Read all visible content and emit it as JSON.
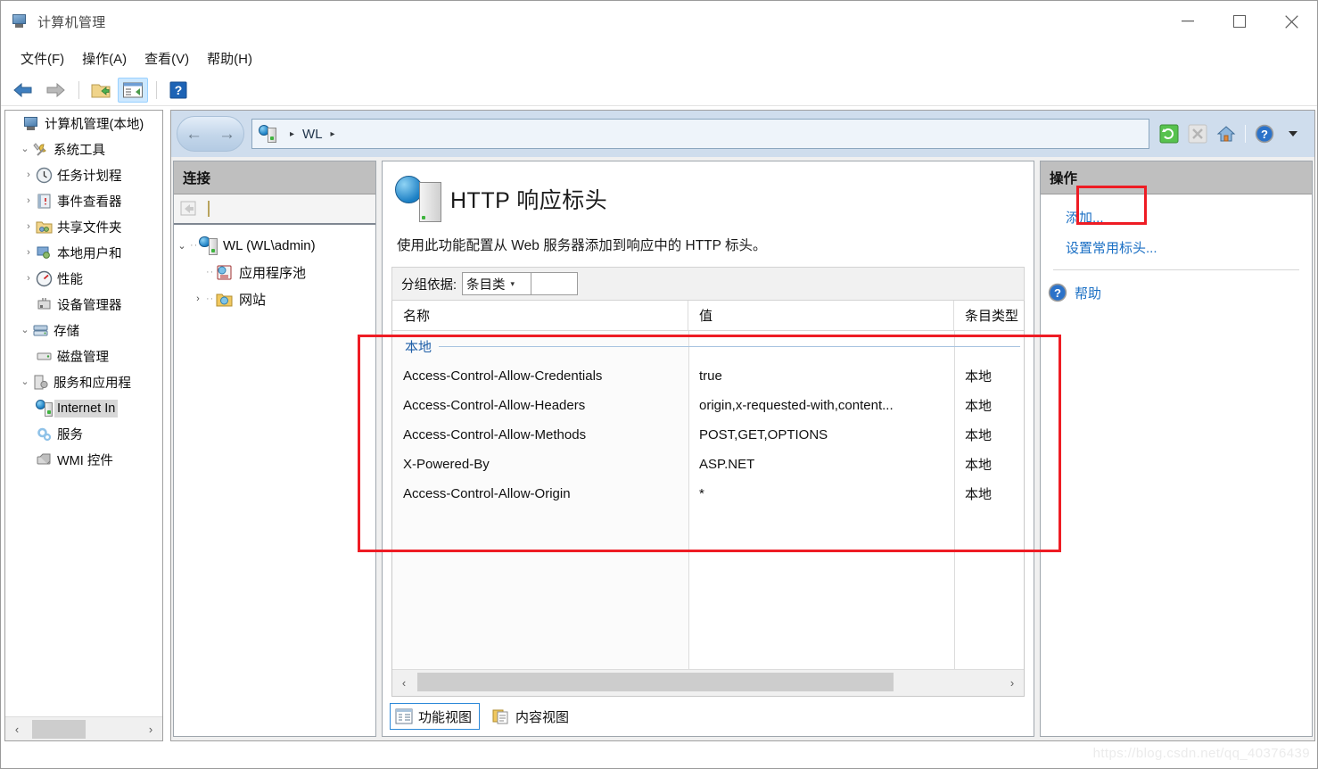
{
  "window": {
    "title": "计算机管理",
    "icon": "computer-management-icon",
    "minimize_label": "最小化",
    "maximize_label": "最大化",
    "close_label": "关闭"
  },
  "menubar": {
    "items": [
      {
        "label": "文件(F)",
        "name": "menu-file"
      },
      {
        "label": "操作(A)",
        "name": "menu-action"
      },
      {
        "label": "查看(V)",
        "name": "menu-view"
      },
      {
        "label": "帮助(H)",
        "name": "menu-help"
      }
    ]
  },
  "mmc_toolbar": {
    "buttons": [
      {
        "name": "back-button",
        "icon": "arrow-left-icon",
        "enabled": true
      },
      {
        "name": "forward-button",
        "icon": "arrow-right-icon",
        "enabled": true
      },
      {
        "name": "show-hide-console-tree-button",
        "icon": "folder-up-icon",
        "enabled": true
      },
      {
        "name": "show-hide-action-pane-button",
        "icon": "pane-icon",
        "pressed": true
      },
      {
        "name": "help-button",
        "icon": "question-icon",
        "enabled": true
      }
    ]
  },
  "console_tree": {
    "nodes": [
      {
        "label": "计算机管理(本地)",
        "icon": "computer-icon",
        "level": 0,
        "twist": "",
        "selected": false
      },
      {
        "label": "系统工具",
        "icon": "tools-icon",
        "level": 1,
        "twist": "v",
        "selected": false
      },
      {
        "label": "任务计划程",
        "icon": "clock-icon",
        "level": 2,
        "twist": ">",
        "selected": false
      },
      {
        "label": "事件查看器",
        "icon": "eventlog-icon",
        "level": 2,
        "twist": ">",
        "selected": false
      },
      {
        "label": "共享文件夹",
        "icon": "shared-folder-icon",
        "level": 2,
        "twist": ">",
        "selected": false
      },
      {
        "label": "本地用户和",
        "icon": "users-icon",
        "level": 2,
        "twist": ">",
        "selected": false
      },
      {
        "label": "性能",
        "icon": "performance-icon",
        "level": 2,
        "twist": ">",
        "selected": false
      },
      {
        "label": "设备管理器",
        "icon": "device-manager-icon",
        "level": 2,
        "twist": "",
        "selected": false
      },
      {
        "label": "存储",
        "icon": "storage-icon",
        "level": 1,
        "twist": "v",
        "selected": false
      },
      {
        "label": "磁盘管理",
        "icon": "disk-management-icon",
        "level": 2,
        "twist": "",
        "selected": false
      },
      {
        "label": "服务和应用程",
        "icon": "services-apps-icon",
        "level": 1,
        "twist": "v",
        "selected": false
      },
      {
        "label": "Internet In",
        "icon": "iis-icon",
        "level": 2,
        "twist": "",
        "selected": true
      },
      {
        "label": "服务",
        "icon": "services-icon",
        "level": 2,
        "twist": "",
        "selected": false
      },
      {
        "label": "WMI 控件",
        "icon": "wmi-icon",
        "level": 2,
        "twist": "",
        "selected": false
      }
    ],
    "scrollbar": {
      "left_arrow": "‹",
      "right_arrow": "›"
    }
  },
  "address_bar": {
    "back_arrow": "←",
    "forward_arrow": "→",
    "breadcrumb_icon": "server-icon",
    "separator": "▸",
    "path": [
      "WL"
    ],
    "tools": [
      {
        "name": "refresh-button",
        "icon": "refresh-icon",
        "enabled": true
      },
      {
        "name": "stop-button",
        "icon": "stop-x-icon",
        "enabled": false
      },
      {
        "name": "home-button",
        "icon": "home-icon",
        "enabled": true
      },
      {
        "name": "help-button",
        "icon": "help-circle-icon",
        "enabled": true
      },
      {
        "name": "help-dropdown-button",
        "icon": "chevron-down-icon",
        "enabled": true
      }
    ]
  },
  "connections": {
    "header": "连接",
    "toolbar_icon": "connect-icon",
    "nodes": [
      {
        "label": "WL (WL\\admin)",
        "icon": "server-icon",
        "level": 0,
        "twist": "v",
        "selected": true
      },
      {
        "label": "应用程序池",
        "icon": "app-pools-icon",
        "level": 1,
        "twist": "",
        "selected": false
      },
      {
        "label": "网站",
        "icon": "sites-folder-icon",
        "level": 1,
        "twist": ">",
        "selected": false
      }
    ]
  },
  "main": {
    "icon": "http-response-headers-icon",
    "title": "HTTP 响应标头",
    "description": "使用此功能配置从 Web 服务器添加到响应中的 HTTP 标头。",
    "group_by": {
      "label": "分组依据:",
      "value": "条目类型",
      "value_clipped": "条目",
      "arrow": "▾"
    },
    "grid": {
      "columns": [
        "名称",
        "值",
        "条目类型"
      ],
      "column_3_clipped": "条目类型",
      "groups": [
        {
          "name": "本地",
          "rows": [
            {
              "name": "Access-Control-Allow-Credentials",
              "value": "true",
              "entry_type": "本地"
            },
            {
              "name": "Access-Control-Allow-Headers",
              "value": "origin,x-requested-with,content...",
              "entry_type": "本地"
            },
            {
              "name": "Access-Control-Allow-Methods",
              "value": "POST,GET,OPTIONS",
              "entry_type": "本地"
            },
            {
              "name": "X-Powered-By",
              "value": "ASP.NET",
              "entry_type": "本地"
            },
            {
              "name": "Access-Control-Allow-Origin",
              "value": "*",
              "entry_type": "本地"
            }
          ]
        }
      ],
      "scrollbar": {
        "left_arrow": "‹",
        "right_arrow": "›"
      }
    },
    "view_tabs": [
      {
        "label": "功能视图",
        "icon": "features-view-icon",
        "active": true
      },
      {
        "label": "内容视图",
        "icon": "content-view-icon",
        "active": false
      }
    ]
  },
  "actions": {
    "header": "操作",
    "items": [
      {
        "label": "添加...",
        "name": "action-add",
        "icon": null,
        "highlighted": true
      },
      {
        "label": "设置常用标头...",
        "name": "action-set-common-headers",
        "icon": null,
        "highlighted": false
      },
      {
        "label": "帮助",
        "name": "action-help",
        "icon": "help-circle-icon",
        "highlighted": false
      }
    ]
  },
  "annotations": {
    "highlight_color": "#ee1c24",
    "boxes": [
      {
        "name": "headers-table-highlight"
      },
      {
        "name": "add-action-highlight"
      }
    ]
  },
  "watermark": "https://blog.csdn.net/qq_40376439"
}
